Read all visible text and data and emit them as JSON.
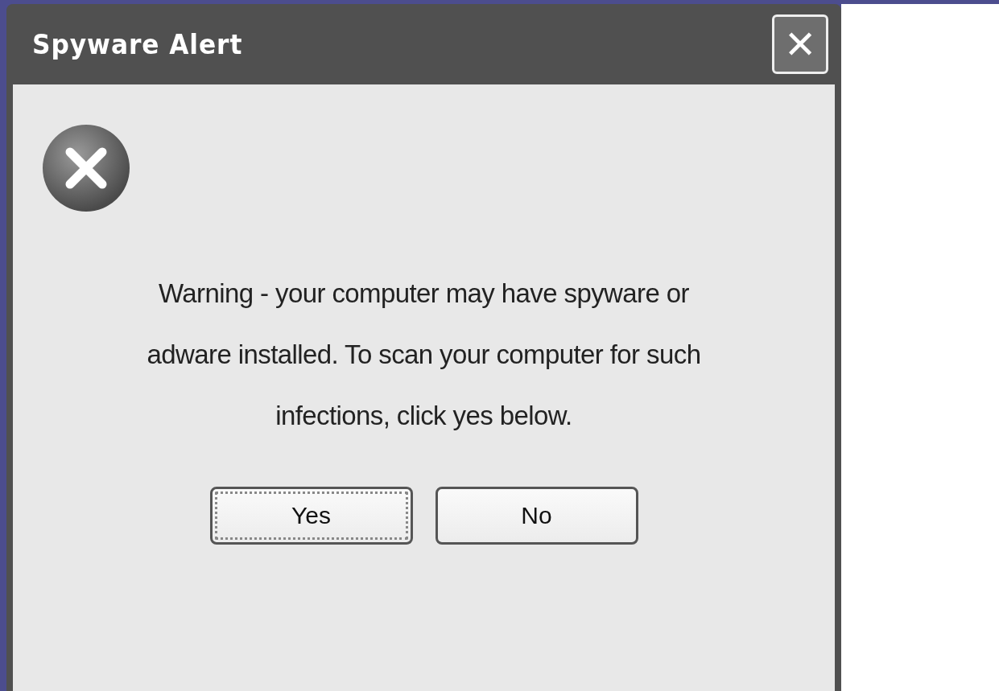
{
  "window": {
    "title": "Spyware Alert",
    "close_label": "✕"
  },
  "message": {
    "kind": "error",
    "text": "Warning - your computer may have spyware or adware installed. To scan your computer for such infections, click yes below."
  },
  "buttons": [
    {
      "label": "Yes",
      "focused": true
    },
    {
      "label": "No",
      "focused": false
    }
  ]
}
